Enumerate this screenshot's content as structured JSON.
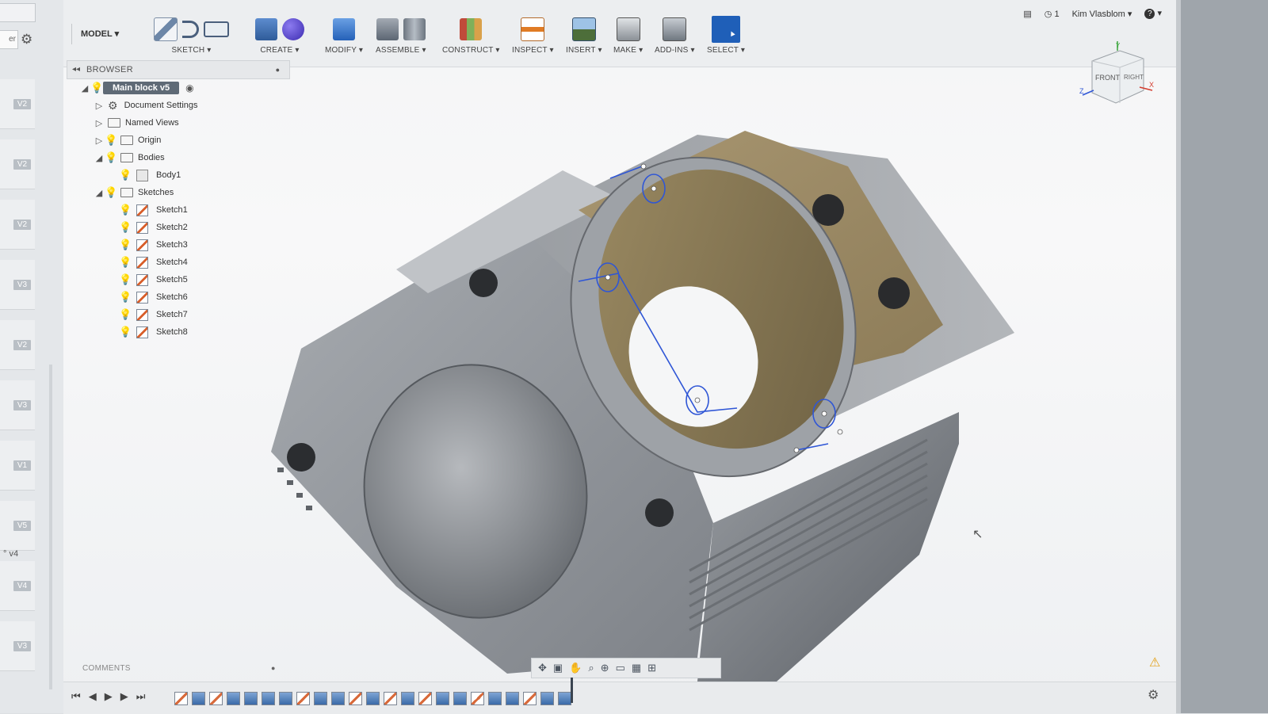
{
  "left_panel": {
    "small_field": "er",
    "versions": [
      "V2",
      "V2",
      "V2",
      "V3",
      "V2",
      "V3",
      "V1",
      "V5",
      "V4",
      "V3"
    ],
    "v4_text": "° v4"
  },
  "toolbar": {
    "workspace": "MODEL",
    "groups": [
      {
        "label": "SKETCH"
      },
      {
        "label": "CREATE"
      },
      {
        "label": "MODIFY"
      },
      {
        "label": "ASSEMBLE"
      },
      {
        "label": "CONSTRUCT"
      },
      {
        "label": "INSPECT"
      },
      {
        "label": "INSERT"
      },
      {
        "label": "MAKE"
      },
      {
        "label": "ADD-INS"
      },
      {
        "label": "SELECT"
      }
    ],
    "job_count": "1",
    "user_name": "Kim Vlasblom",
    "help": "?"
  },
  "browser": {
    "title": "BROWSER",
    "root": "Main block v5",
    "items": {
      "document_settings": "Document Settings",
      "named_views": "Named Views",
      "origin": "Origin",
      "bodies": "Bodies",
      "body1": "Body1",
      "sketches": "Sketches"
    },
    "sketches": [
      "Sketch1",
      "Sketch2",
      "Sketch3",
      "Sketch4",
      "Sketch5",
      "Sketch6",
      "Sketch7",
      "Sketch8"
    ]
  },
  "viewcube": {
    "front": "FRONT",
    "right": "RIGHT",
    "axis_x": "X",
    "axis_y": "Y",
    "axis_z": "Z"
  },
  "comments": {
    "label": "COMMENTS"
  },
  "icons": {
    "gear": "gear-icon",
    "bulb": "lightbulb-icon",
    "warning": "warning-icon",
    "settings": "settings-icon"
  },
  "colors": {
    "select_blue": "#1f5fb8",
    "sketch_line": "#2f56d6",
    "model_grey": "#8e9399",
    "model_bronze": "#8a7a56"
  }
}
